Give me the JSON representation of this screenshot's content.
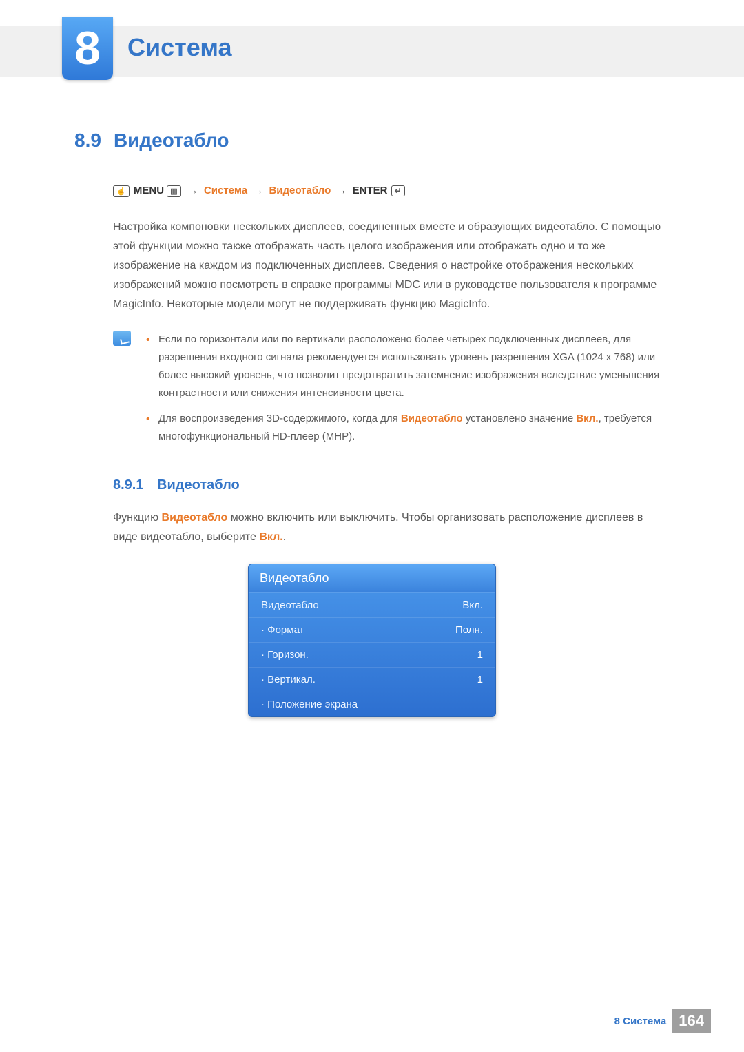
{
  "chapter": {
    "number": "8",
    "title": "Система"
  },
  "section": {
    "number": "8.9",
    "title": "Видеотабло"
  },
  "breadcrumb": {
    "menu_label": "MENU",
    "path1": "Система",
    "path2": "Видеотабло",
    "enter_label": "ENTER"
  },
  "intro_paragraph": "Настройка компоновки нескольких дисплеев, соединенных вместе и образующих видеотабло. С помощью этой функции можно также отображать часть целого изображения или отображать одно и то же изображение на каждом из подключенных дисплеев. Сведения о настройке отображения нескольких изображений можно посмотреть в справке программы MDC или в руководстве пользователя к программе MagicInfo. Некоторые модели могут не поддерживать функцию MagicInfo.",
  "notes": [
    {
      "text": "Если по горизонтали или по вертикали расположено более четырех подключенных дисплеев, для разрешения входного сигнала рекомендуется использовать уровень разрешения XGA (1024 x 768) или более высокий уровень, что позволит предотвратить затемнение изображения вследствие уменьшения контрастности или снижения интенсивности цвета."
    },
    {
      "pre": "Для воспроизведения 3D-содержимого, когда для ",
      "bold1": "Видеотабло",
      "mid": " установлено значение ",
      "bold2": "Вкл.",
      "post": ", требуется многофункциональный HD-плеер (MHP)."
    }
  ],
  "subsection": {
    "number": "8.9.1",
    "title": "Видеотабло"
  },
  "sub_paragraph": {
    "pre": "Функцию ",
    "bold1": "Видеотабло",
    "mid": " можно включить или выключить. Чтобы организовать расположение дисплеев в виде видеотабло, выберите ",
    "bold2": "Вкл.",
    "post": "."
  },
  "osd": {
    "title": "Видеотабло",
    "rows": [
      {
        "label": "Видеотабло",
        "value": "Вкл.",
        "indent": false
      },
      {
        "label": "Формат",
        "value": "Полн.",
        "indent": true
      },
      {
        "label": "Горизон.",
        "value": "1",
        "indent": true
      },
      {
        "label": "Вертикал.",
        "value": "1",
        "indent": true
      },
      {
        "label": "Положение экрана",
        "value": "",
        "indent": true
      }
    ]
  },
  "footer": {
    "label": "8 Система",
    "page": "164"
  }
}
